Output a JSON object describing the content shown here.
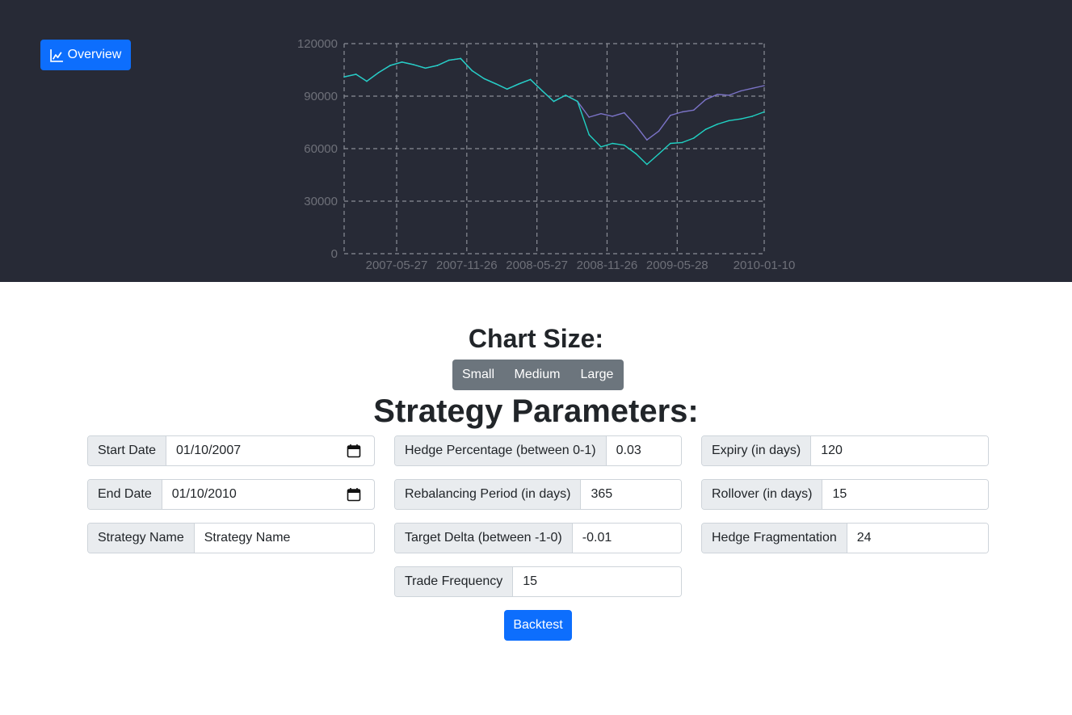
{
  "nav": {
    "overview_label": "Overview",
    "overview_icon": "line-chart-icon"
  },
  "colors": {
    "background_dark": "#272a36",
    "primary": "#0d6efd",
    "secondary": "#6c757d",
    "series_portfolio": "#7b73c7",
    "series_benchmark": "#20d2c4"
  },
  "chart_data": {
    "type": "line",
    "title": "",
    "xlabel": "",
    "ylabel": "",
    "ylim": [
      0,
      120000
    ],
    "x_ticks": [
      "2007-05-27",
      "2007-11-26",
      "2008-05-27",
      "2008-11-26",
      "2009-05-28",
      "2010-01-10"
    ],
    "y_ticks": [
      "0",
      "30000",
      "60000",
      "90000",
      "120000"
    ],
    "grid": true,
    "series": [
      {
        "color": "#7b73c7",
        "x": [
          "2007-01-10",
          "2007-02-10",
          "2007-03-10",
          "2007-04-10",
          "2007-05-10",
          "2007-06-10",
          "2007-07-10",
          "2007-08-10",
          "2007-09-10",
          "2007-10-10",
          "2007-11-10",
          "2007-12-10",
          "2008-01-10",
          "2008-02-10",
          "2008-03-10",
          "2008-04-10",
          "2008-05-10",
          "2008-06-10",
          "2008-07-10",
          "2008-08-10",
          "2008-09-10",
          "2008-10-10",
          "2008-11-10",
          "2008-12-10",
          "2009-01-10",
          "2009-02-10",
          "2009-03-10",
          "2009-04-10",
          "2009-05-10",
          "2009-06-10",
          "2009-07-10",
          "2009-08-10",
          "2009-09-10",
          "2009-10-10",
          "2009-11-10",
          "2009-12-10",
          "2010-01-10"
        ],
        "y": [
          101000,
          102500,
          98500,
          103500,
          107500,
          109500,
          108000,
          106000,
          107500,
          110500,
          111500,
          104500,
          100000,
          97000,
          94000,
          97000,
          99500,
          93000,
          87000,
          90500,
          87000,
          78000,
          80000,
          78500,
          80500,
          73000,
          65000,
          70000,
          79000,
          81000,
          82000,
          88000,
          91000,
          90500,
          93000,
          94500,
          96000
        ]
      },
      {
        "color": "#20d2c4",
        "x": [
          "2007-01-10",
          "2007-02-10",
          "2007-03-10",
          "2007-04-10",
          "2007-05-10",
          "2007-06-10",
          "2007-07-10",
          "2007-08-10",
          "2007-09-10",
          "2007-10-10",
          "2007-11-10",
          "2007-12-10",
          "2008-01-10",
          "2008-02-10",
          "2008-03-10",
          "2008-04-10",
          "2008-05-10",
          "2008-06-10",
          "2008-07-10",
          "2008-08-10",
          "2008-09-10",
          "2008-10-10",
          "2008-11-10",
          "2008-12-10",
          "2009-01-10",
          "2009-02-10",
          "2009-03-10",
          "2009-04-10",
          "2009-05-10",
          "2009-06-10",
          "2009-07-10",
          "2009-08-10",
          "2009-09-10",
          "2009-10-10",
          "2009-11-10",
          "2009-12-10",
          "2010-01-10"
        ],
        "y": [
          101000,
          102500,
          98500,
          103500,
          107500,
          109500,
          108000,
          106000,
          107500,
          110500,
          111500,
          104500,
          100000,
          97000,
          94000,
          97000,
          99500,
          93000,
          87000,
          90500,
          87000,
          68000,
          61000,
          63000,
          62000,
          57000,
          51000,
          57000,
          63000,
          63500,
          66000,
          71000,
          74000,
          76000,
          77000,
          78500,
          81000
        ]
      }
    ]
  },
  "chart_size": {
    "title": "Chart Size:",
    "options": [
      "Small",
      "Medium",
      "Large"
    ]
  },
  "params": {
    "title": "Strategy Parameters:",
    "start_date": {
      "label": "Start Date",
      "value": "01/10/2007"
    },
    "end_date": {
      "label": "End Date",
      "value": "01/10/2010"
    },
    "strategy_name": {
      "label": "Strategy Name",
      "value": "Strategy Name"
    },
    "hedge_percentage": {
      "label": "Hedge Percentage (between 0-1)",
      "value": "0.03"
    },
    "rebalancing_period": {
      "label": "Rebalancing Period (in days)",
      "value": "365"
    },
    "target_delta": {
      "label": "Target Delta (between -1-0)",
      "value": "-0.01"
    },
    "trade_frequency": {
      "label": "Trade Frequency",
      "value": "15"
    },
    "expiry": {
      "label": "Expiry (in days)",
      "value": "120"
    },
    "rollover": {
      "label": "Rollover (in days)",
      "value": "15"
    },
    "hedge_fragmentation": {
      "label": "Hedge Fragmentation",
      "value": "24"
    },
    "calendar_icon": "calendar-icon"
  },
  "actions": {
    "backtest_label": "Backtest"
  }
}
